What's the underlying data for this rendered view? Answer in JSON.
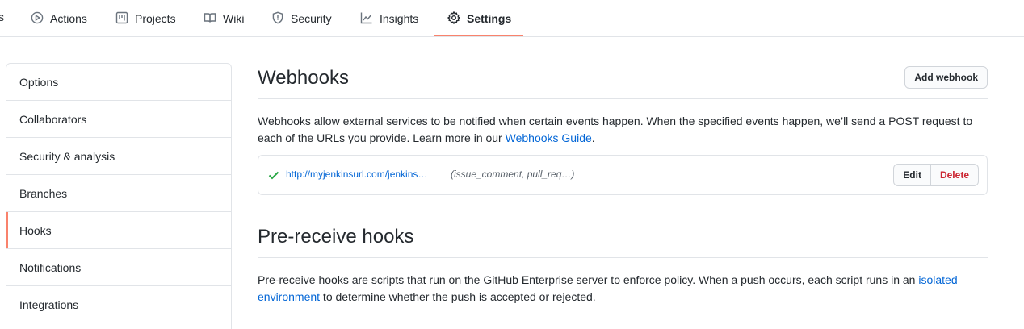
{
  "topnav": {
    "truncated_text": "s",
    "tabs": [
      {
        "label": "Actions",
        "icon": "play-circle-icon"
      },
      {
        "label": "Projects",
        "icon": "project-board-icon"
      },
      {
        "label": "Wiki",
        "icon": "book-icon"
      },
      {
        "label": "Security",
        "icon": "shield-icon"
      },
      {
        "label": "Insights",
        "icon": "graph-icon"
      },
      {
        "label": "Settings",
        "icon": "gear-icon",
        "active": true
      }
    ]
  },
  "sidebar": {
    "items": [
      {
        "label": "Options"
      },
      {
        "label": "Collaborators"
      },
      {
        "label": "Security & analysis"
      },
      {
        "label": "Branches"
      },
      {
        "label": "Hooks",
        "active": true
      },
      {
        "label": "Notifications"
      },
      {
        "label": "Integrations"
      }
    ]
  },
  "webhooks": {
    "title": "Webhooks",
    "add_button": "Add webhook",
    "description": "Webhooks allow external services to be notified when certain events happen. When the specified events happen, we’ll send a POST request to each of the URLs you provide. Learn more in our ",
    "guide_link": "Webhooks Guide",
    "description_end": ".",
    "hook": {
      "url": "http://myjenkinsurl.com/jenkins…",
      "events": "(issue_comment, pull_req…)",
      "edit_label": "Edit",
      "delete_label": "Delete"
    }
  },
  "prereceive": {
    "title": "Pre-receive hooks",
    "description": "Pre-receive hooks are scripts that run on the GitHub Enterprise server to enforce policy. When a push occurs, each script runs in an ",
    "link": "isolated environment",
    "description_end": " to determine whether the push is accepted or rejected."
  },
  "colors": {
    "accent": "#f9826c",
    "link": "#0366d6",
    "danger": "#cb2431",
    "success": "#28a745"
  }
}
